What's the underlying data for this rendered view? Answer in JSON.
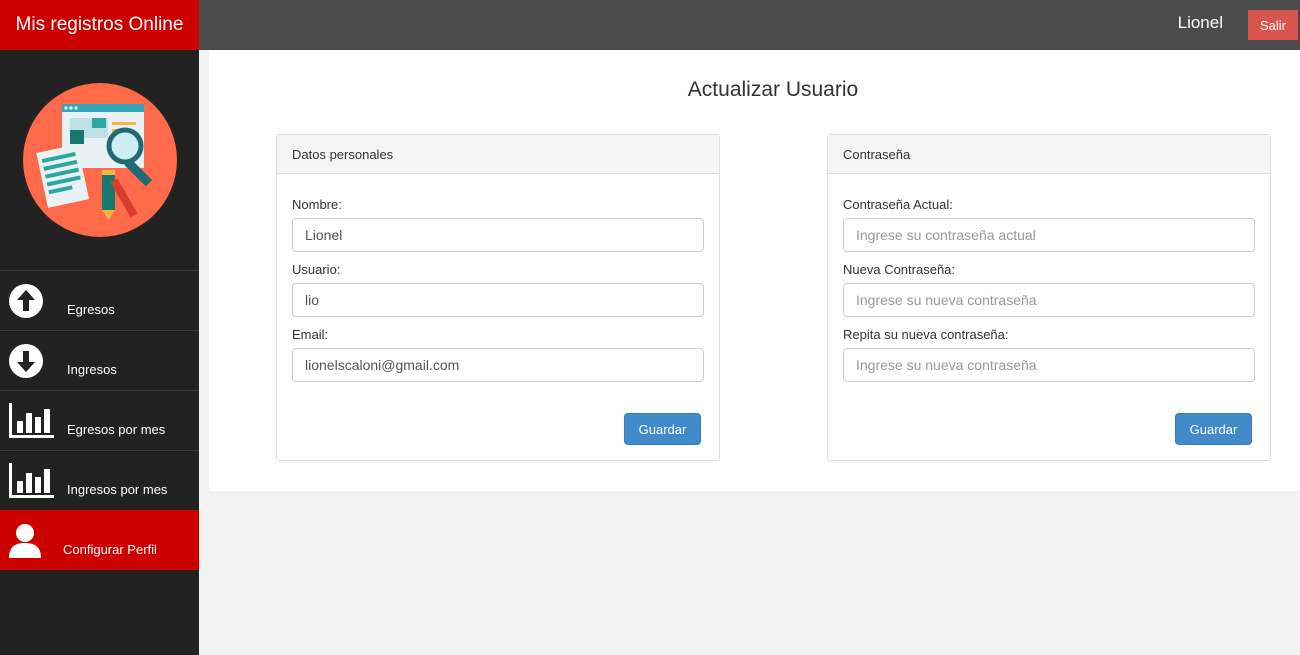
{
  "brand": {
    "title": "Mis registros Online",
    "color": "#cc0000"
  },
  "topbar": {
    "username": "Lionel",
    "logout_label": "Salir"
  },
  "sidebar": {
    "items": [
      {
        "label": "Egresos",
        "icon": "arrow-up-circle-icon"
      },
      {
        "label": "Ingresos",
        "icon": "arrow-down-circle-icon"
      },
      {
        "label": "Egresos por mes",
        "icon": "bar-chart-icon"
      },
      {
        "label": "Ingresos por mes",
        "icon": "bar-chart-icon"
      },
      {
        "label": "Configurar Perfil",
        "icon": "user-icon",
        "active": true
      }
    ]
  },
  "main": {
    "title": "Actualizar Usuario",
    "personal": {
      "heading": "Datos personales",
      "name_label": "Nombre:",
      "name_value": "Lionel",
      "user_label": "Usuario:",
      "user_value": "lio",
      "email_label": "Email:",
      "email_value": "lionelscaloni@gmail.com",
      "save_label": "Guardar"
    },
    "password": {
      "heading": "Contraseña",
      "current_label": "Contraseña Actual:",
      "current_placeholder": "Ingrese su contraseña actual",
      "new_label": "Nueva Contraseña:",
      "new_placeholder": "Ingrese su nueva contraseña",
      "repeat_label": "Repita su nueva contraseña:",
      "repeat_placeholder": "Ingrese su nueva contraseña",
      "save_label": "Guardar"
    }
  },
  "colors": {
    "accent": "#cc0000",
    "topbar": "#4b4b4b",
    "sidebar": "#222222",
    "primary_button": "#428bca",
    "logout_button": "#d9534f"
  }
}
